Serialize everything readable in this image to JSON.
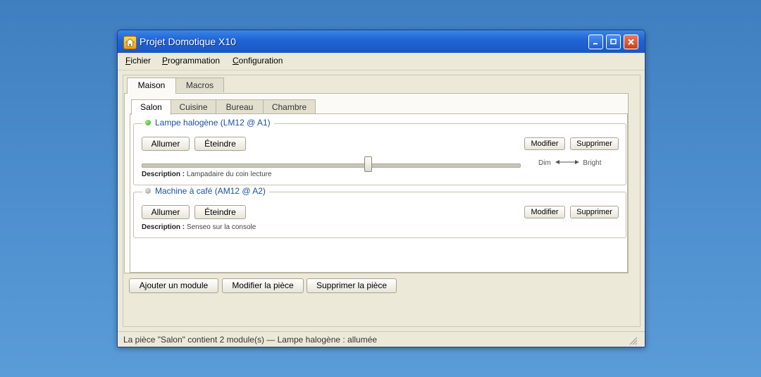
{
  "window": {
    "title": "Projet Domotique X10"
  },
  "menu": [
    "Fichier",
    "Programmation",
    "Configuration"
  ],
  "tabs": [
    "Maison",
    "Macros"
  ],
  "rooms": [
    "Salon",
    "Cuisine",
    "Bureau",
    "Chambre"
  ],
  "modules": [
    {
      "name": "Lampe halogène (LM12 @ A1)",
      "status": "on",
      "on_label": "Allumer",
      "off_label": "Éteindre",
      "edit_label": "Modifier",
      "delete_label": "Supprimer",
      "dim_label": "Dim",
      "bright_label": "Bright",
      "level": 0.6,
      "desc_label": "Description :",
      "description": "Lampadaire du coin lecture"
    },
    {
      "name": "Machine à café (AM12 @ A2)",
      "status": "off",
      "on_label": "Allumer",
      "off_label": "Éteindre",
      "edit_label": "Modifier",
      "delete_label": "Supprimer",
      "desc_label": "Description :",
      "description": "Senseo sur la console"
    }
  ],
  "room_actions": [
    "Ajouter un module",
    "Modifier la pièce",
    "Supprimer la pièce"
  ],
  "status": "La pièce \"Salon\" contient 2 module(s) — Lampe halogène : allumée"
}
